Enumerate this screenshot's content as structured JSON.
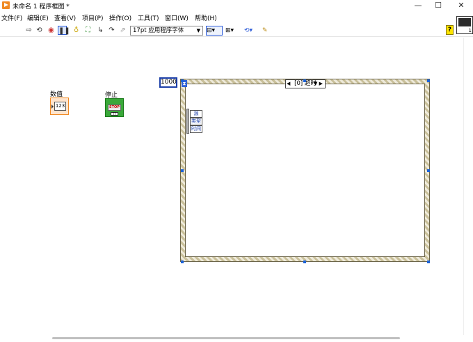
{
  "window": {
    "title": "未命名 1 程序框图 *",
    "minimize": "—",
    "maximize": "☐",
    "close": "✕"
  },
  "menu": [
    {
      "label": "文件(F)"
    },
    {
      "label": "编辑(E)"
    },
    {
      "label": "查看(V)"
    },
    {
      "label": "项目(P)"
    },
    {
      "label": "操作(O)"
    },
    {
      "label": "工具(T)"
    },
    {
      "label": "窗口(W)"
    },
    {
      "label": "帮助(H)"
    }
  ],
  "toolbar": {
    "font": "17pt 应用程序字体",
    "help": "?",
    "vi_icon_number": "1"
  },
  "diagram": {
    "numeric_label": "数值",
    "numeric_value": "123",
    "stop_label": "停止",
    "stop_button_text": "STOP",
    "stop_tf": "TF",
    "timeout_constant": "1000",
    "case_selector": "[0] 超时",
    "event_data": [
      "源",
      "类型",
      "时间"
    ]
  }
}
